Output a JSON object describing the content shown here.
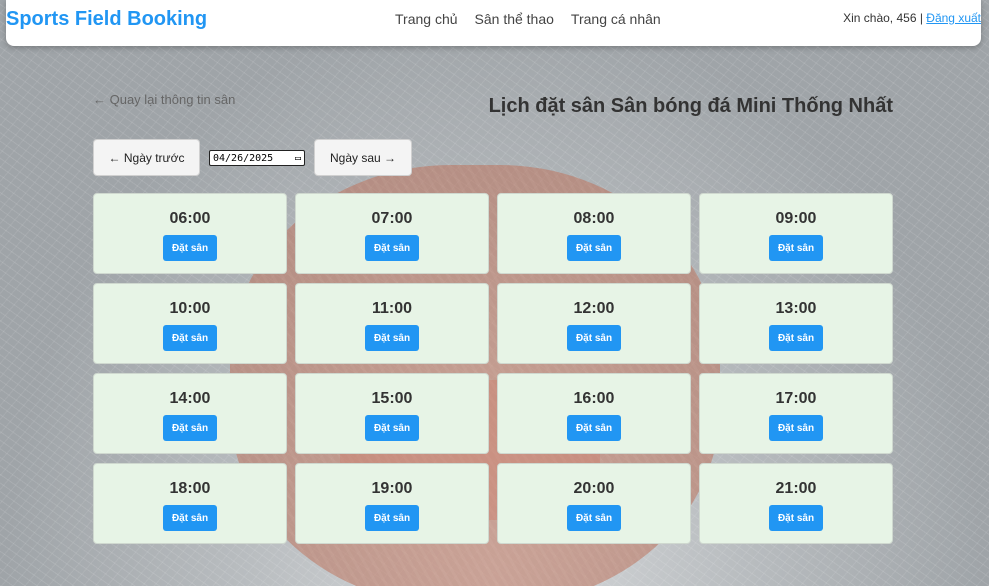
{
  "header": {
    "brand": "Sports Field Booking",
    "nav": [
      {
        "label": "Trang chủ"
      },
      {
        "label": "Sân thể thao"
      },
      {
        "label": "Trang cá nhân"
      }
    ],
    "greeting": "Xin chào, 456 |",
    "logout": "Đăng xuất"
  },
  "page": {
    "back_link": "← Quay lại thông tin sân",
    "title": "Lịch đặt sân Sân bóng đá Mini Thống Nhất",
    "prev_day": "← Ngày trước",
    "next_day": "Ngày sau →",
    "date": "04/26/2025"
  },
  "slots": [
    {
      "time": "06:00",
      "button": "Đặt sân"
    },
    {
      "time": "07:00",
      "button": "Đặt sân"
    },
    {
      "time": "08:00",
      "button": "Đặt sân"
    },
    {
      "time": "09:00",
      "button": "Đặt sân"
    },
    {
      "time": "10:00",
      "button": "Đặt sân"
    },
    {
      "time": "11:00",
      "button": "Đặt sân"
    },
    {
      "time": "12:00",
      "button": "Đặt sân"
    },
    {
      "time": "13:00",
      "button": "Đặt sân"
    },
    {
      "time": "14:00",
      "button": "Đặt sân"
    },
    {
      "time": "15:00",
      "button": "Đặt sân"
    },
    {
      "time": "16:00",
      "button": "Đặt sân"
    },
    {
      "time": "17:00",
      "button": "Đặt sân"
    },
    {
      "time": "18:00",
      "button": "Đặt sân"
    },
    {
      "time": "19:00",
      "button": "Đặt sân"
    },
    {
      "time": "20:00",
      "button": "Đặt sân"
    },
    {
      "time": "21:00",
      "button": "Đặt sân"
    }
  ],
  "colors": {
    "accent": "#2196f3",
    "slot_bg": "#e7f4e6"
  }
}
